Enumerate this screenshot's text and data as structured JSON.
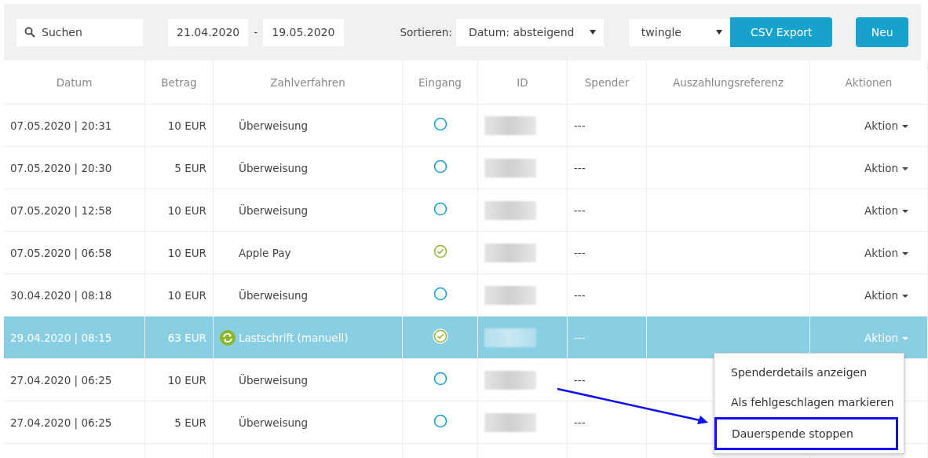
{
  "toolbar": {
    "search": {
      "placeholder": "Suchen"
    },
    "date_from": "21.04.2020",
    "date_separator": "-",
    "date_to": "19.05.2020",
    "sort_label": "Sortieren:",
    "sort_value": "Datum: absteigend",
    "source_value": "twingle",
    "export_button": "CSV Export",
    "new_button": "Neu"
  },
  "table": {
    "columns": [
      "Datum",
      "Betrag",
      "Zahlverfahren",
      "Eingang",
      "ID",
      "Spender",
      "Auszahlungsreferenz",
      "Aktionen"
    ],
    "rows": [
      {
        "date": "07.05.2020 | 20:31",
        "amount": "10 EUR",
        "method": "Überweisung",
        "recurring": false,
        "received": false,
        "donor": "---",
        "action": "Aktion",
        "selected": false
      },
      {
        "date": "07.05.2020 | 20:30",
        "amount": "5 EUR",
        "method": "Überweisung",
        "recurring": false,
        "received": false,
        "donor": "---",
        "action": "Aktion",
        "selected": false
      },
      {
        "date": "07.05.2020 | 12:58",
        "amount": "10 EUR",
        "method": "Überweisung",
        "recurring": false,
        "received": false,
        "donor": "---",
        "action": "Aktion",
        "selected": false
      },
      {
        "date": "07.05.2020 | 06:58",
        "amount": "10 EUR",
        "method": "Apple Pay",
        "recurring": false,
        "received": true,
        "donor": "---",
        "action": "Aktion",
        "selected": false
      },
      {
        "date": "30.04.2020 | 08:18",
        "amount": "10 EUR",
        "method": "Überweisung",
        "recurring": false,
        "received": false,
        "donor": "---",
        "action": "Aktion",
        "selected": false
      },
      {
        "date": "29.04.2020 | 08:15",
        "amount": "63 EUR",
        "method": "Lastschrift (manuell)",
        "recurring": true,
        "received": true,
        "donor": "---",
        "action": "Aktion",
        "selected": true
      },
      {
        "date": "27.04.2020 | 06:25",
        "amount": "10 EUR",
        "method": "Überweisung",
        "recurring": false,
        "received": false,
        "donor": "---",
        "selected": false
      },
      {
        "date": "27.04.2020 | 06:25",
        "amount": "5 EUR",
        "method": "Überweisung",
        "recurring": false,
        "received": false,
        "donor": "---",
        "selected": false
      }
    ]
  },
  "action_menu": {
    "items": [
      {
        "label": "Spenderdetails anzeigen",
        "highlighted": false
      },
      {
        "label": "Als fehlgeschlagen markieren",
        "highlighted": false
      },
      {
        "label": "Dauerspende stoppen",
        "highlighted": true
      }
    ]
  }
}
